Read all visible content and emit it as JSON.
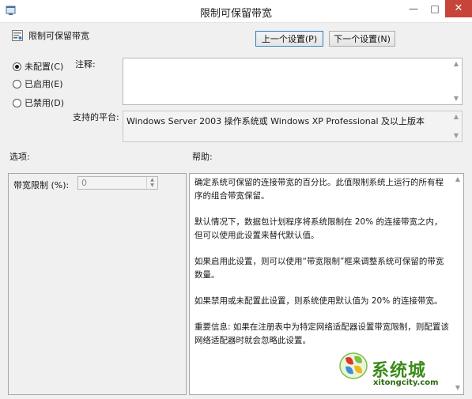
{
  "window": {
    "title": "限制可保留带宽",
    "minimize_glyph": "—",
    "maximize_glyph": "□",
    "close_glyph": "✕"
  },
  "header": {
    "policy_name": "限制可保留带宽",
    "prev_button": "上一个设置(P)",
    "next_button": "下一个设置(N)"
  },
  "state": {
    "options": [
      {
        "label": "未配置(C)",
        "checked": true
      },
      {
        "label": "已启用(E)",
        "checked": false
      },
      {
        "label": "已禁用(D)",
        "checked": false
      }
    ]
  },
  "comment": {
    "label": "注释:",
    "value": ""
  },
  "platform": {
    "label": "支持的平台:",
    "value": "Windows Server 2003 操作系统或 Windows XP Professional 及以上版本"
  },
  "options_section": {
    "label": "选项:",
    "bandwidth_label": "带宽限制 (%):",
    "bandwidth_value": "0"
  },
  "help_section": {
    "label": "帮助:",
    "paragraphs": [
      "确定系统可保留的连接带宽的百分比。此值限制系统上运行的所有程序的组合带宽保留。",
      "默认情况下，数据包计划程序将系统限制在 20% 的连接带宽之内，但可以使用此设置来替代默认值。",
      "如果启用此设置，则可以使用“带宽限制”框来调整系统可保留的带宽数量。",
      "如果禁用或未配置此设置，则系统使用默认值为 20% 的连接带宽。",
      "重要信息: 如果在注册表中为特定网络适配器设置带宽限制，则配置该网络适配器时就会忽略此设置。"
    ]
  },
  "watermark": {
    "title": "系统城",
    "url": "xitongcity.com"
  },
  "colors": {
    "close_button": "#c7443b",
    "watermark_green": "#3c8a1a"
  }
}
